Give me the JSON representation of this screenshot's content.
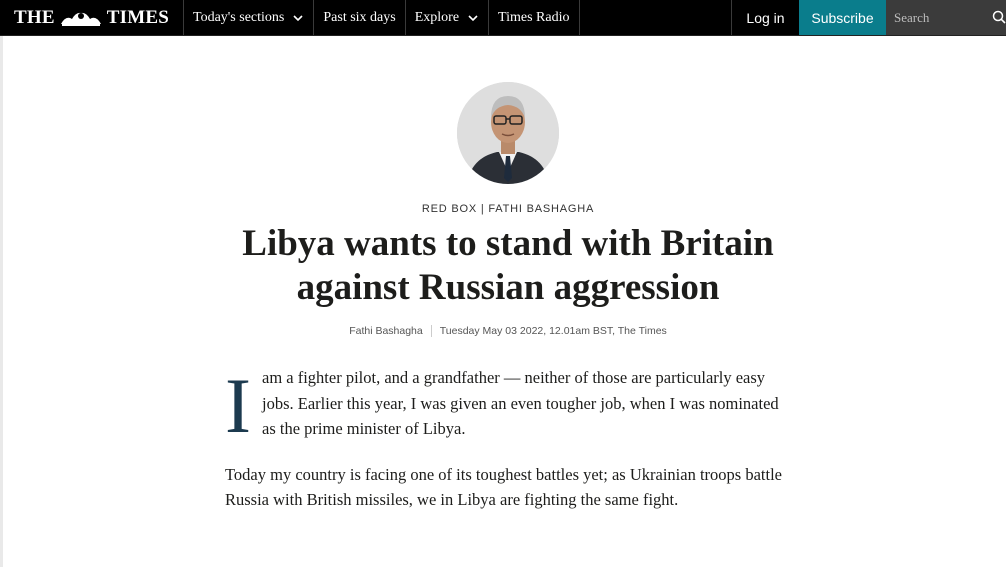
{
  "nav": {
    "masthead_left": "THE",
    "masthead_right": "TIMES",
    "items": [
      {
        "label": "Today's sections",
        "has_dropdown": true
      },
      {
        "label": "Past six days",
        "has_dropdown": false
      },
      {
        "label": "Explore",
        "has_dropdown": true
      },
      {
        "label": "Times Radio",
        "has_dropdown": false
      }
    ],
    "login_label": "Log in",
    "subscribe_label": "Subscribe",
    "search_placeholder": "Search",
    "colors": {
      "bar": "#000000",
      "subscribe_bg": "#0a7d8c",
      "search_bg": "#3b3b3b"
    }
  },
  "article": {
    "kicker": "RED BOX | FATHI BASHAGHA",
    "headline": "Libya wants to stand with Britain against Russian aggression",
    "author": "Fathi Bashagha",
    "dateline": "Tuesday May 03 2022, 12.01am BST, The Times",
    "dropcap": "I",
    "paragraph1": "am a fighter pilot, and a grandfather — neither of those are particularly easy jobs. Earlier this year, I was given an even tougher job, when I was nominated as the prime minister of Libya.",
    "paragraph2": "Today my country is facing one of its toughest battles yet; as Ukrainian troops battle Russia with British missiles, we in Libya are fighting the same fight.",
    "dropcap_color": "#1c3a4f"
  },
  "icons": {
    "crest": "royal-crest-icon",
    "dropdown": "chevron-down-icon",
    "search": "search-icon"
  }
}
